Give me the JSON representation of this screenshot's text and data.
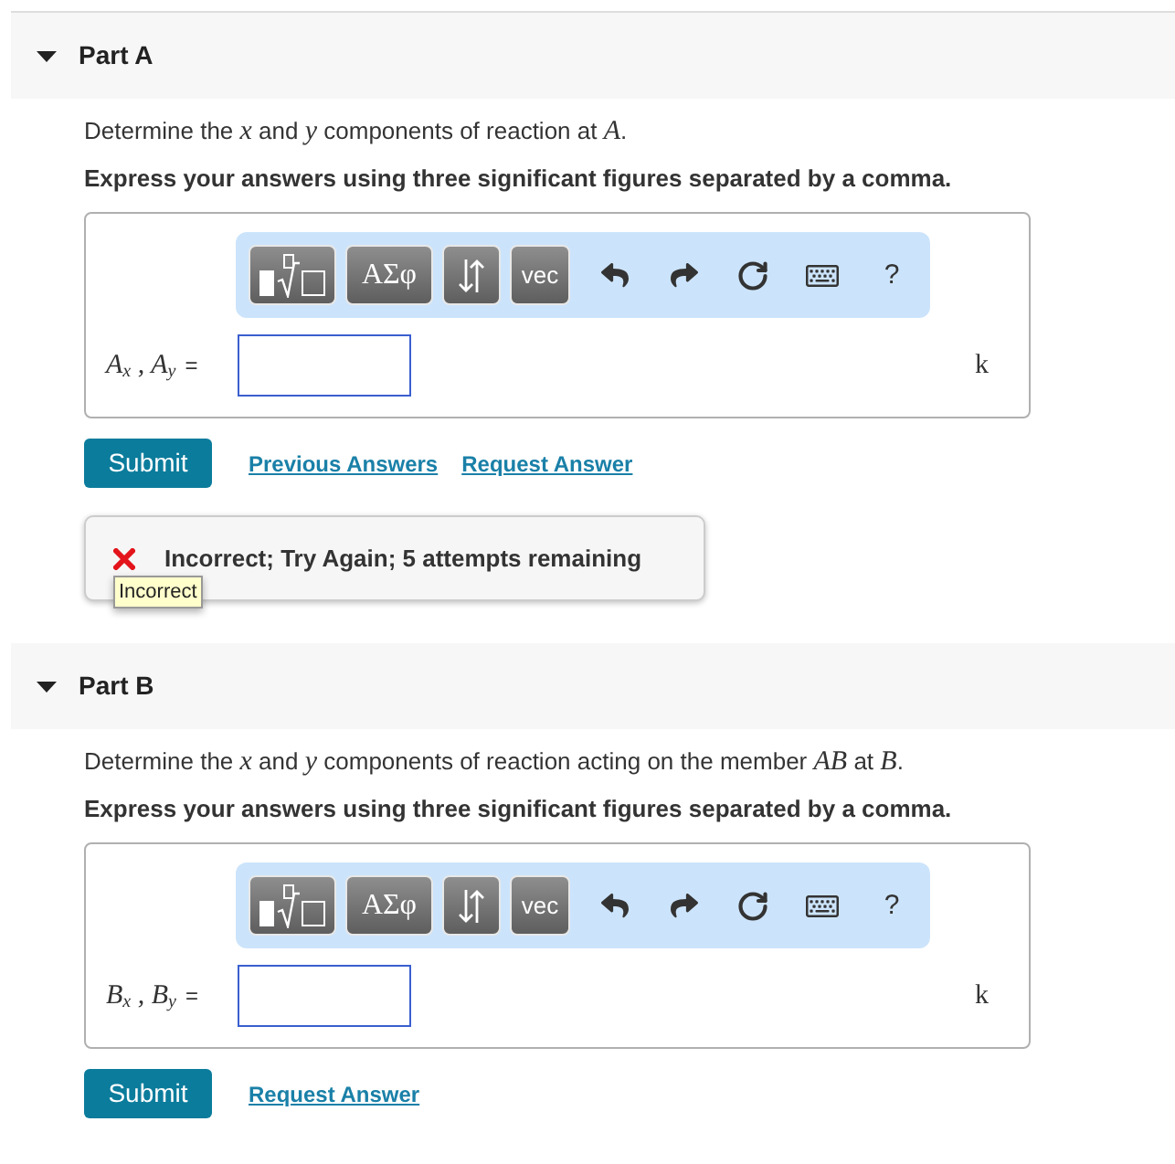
{
  "parts": [
    {
      "title": "Part A",
      "expanded": true,
      "question": "Determine the *x* and *y* components of reaction at *A*.",
      "instruction": "Express your answers using three significant figures separated by a comma.",
      "toolbar": {
        "symbols": "ΑΣφ",
        "vector": "vec",
        "help": "?"
      },
      "answer": {
        "label": "A$_{x}$ , A$_{y}$",
        "equals": "=",
        "unit": "k"
      },
      "submit": "Submit",
      "links": [
        "Previous Answers",
        "Request Answer"
      ],
      "feedback": {
        "kind": "incorrect",
        "message": "Incorrect; Try Again; 5 attempts remaining",
        "tooltip": "Incorrect"
      }
    },
    {
      "title": "Part B",
      "expanded": true,
      "question": "Determine the *x* and *y* components of reaction acting on the member *AB* at *B*.",
      "instruction": "Express your answers using three significant figures separated by a comma.",
      "toolbar": {
        "symbols": "ΑΣφ",
        "vector": "vec",
        "help": "?"
      },
      "answer": {
        "label": "B$_{x}$ , B$_{y}$",
        "equals": "=",
        "unit": "k"
      },
      "submit": "Submit",
      "links": [
        "Request Answer"
      ]
    }
  ]
}
